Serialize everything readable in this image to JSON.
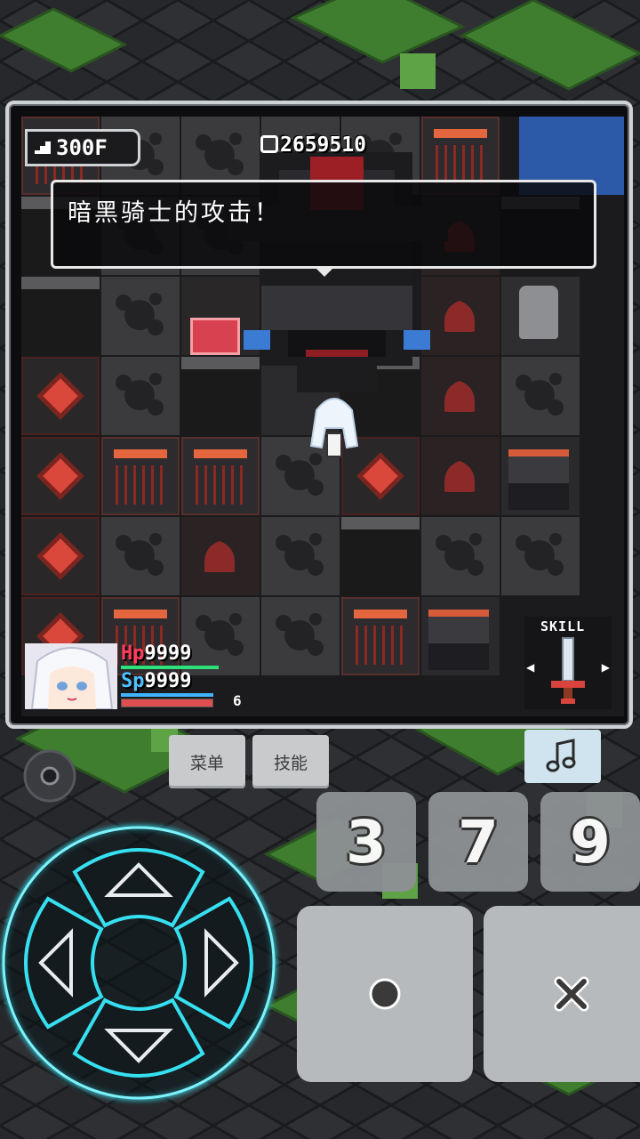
{
  "hud": {
    "floor": "300F",
    "gold": "2659510",
    "dialog": "暗黑骑士的攻击！",
    "hp_label": "Hp",
    "hp_value": "9999",
    "sp_label": "Sp",
    "sp_value": "9999",
    "level": "6",
    "skill_label": "SKILL"
  },
  "buttons": {
    "menu": "菜单",
    "skill": "技能",
    "num_3": "3",
    "num_7": "7",
    "num_9": "9"
  },
  "icons": {
    "music": "music-note-icon",
    "settings": "gear-icon",
    "confirm": "circle-icon",
    "cancel": "cross-icon",
    "skill": "sword-icon"
  },
  "colors": {
    "hp": "#ff3d5b",
    "sp": "#4ec2ff",
    "dpad_glow": "#36e0f0",
    "tile_accent": "#d9483b"
  },
  "tile_map": [
    [
      "machine",
      "rock",
      "rock",
      "boss",
      "boss",
      "machine",
      "chest"
    ],
    [
      "pit",
      "rock",
      "rock",
      "boss",
      "boss",
      "skull",
      "pit"
    ],
    [
      "pit",
      "rock",
      "pit",
      "boss",
      "boss",
      "skull",
      "statue"
    ],
    [
      "rune",
      "rock",
      "pit",
      "hero",
      "pit",
      "skull",
      "rock"
    ],
    [
      "rune",
      "machine",
      "machine",
      "rock",
      "rune",
      "skull",
      "chest"
    ],
    [
      "rune",
      "rock",
      "skull",
      "rock",
      "pit",
      "rock",
      "rock"
    ],
    [
      "rune",
      "machine",
      "rock",
      "rock",
      "machine",
      "chest",
      "skill"
    ]
  ]
}
